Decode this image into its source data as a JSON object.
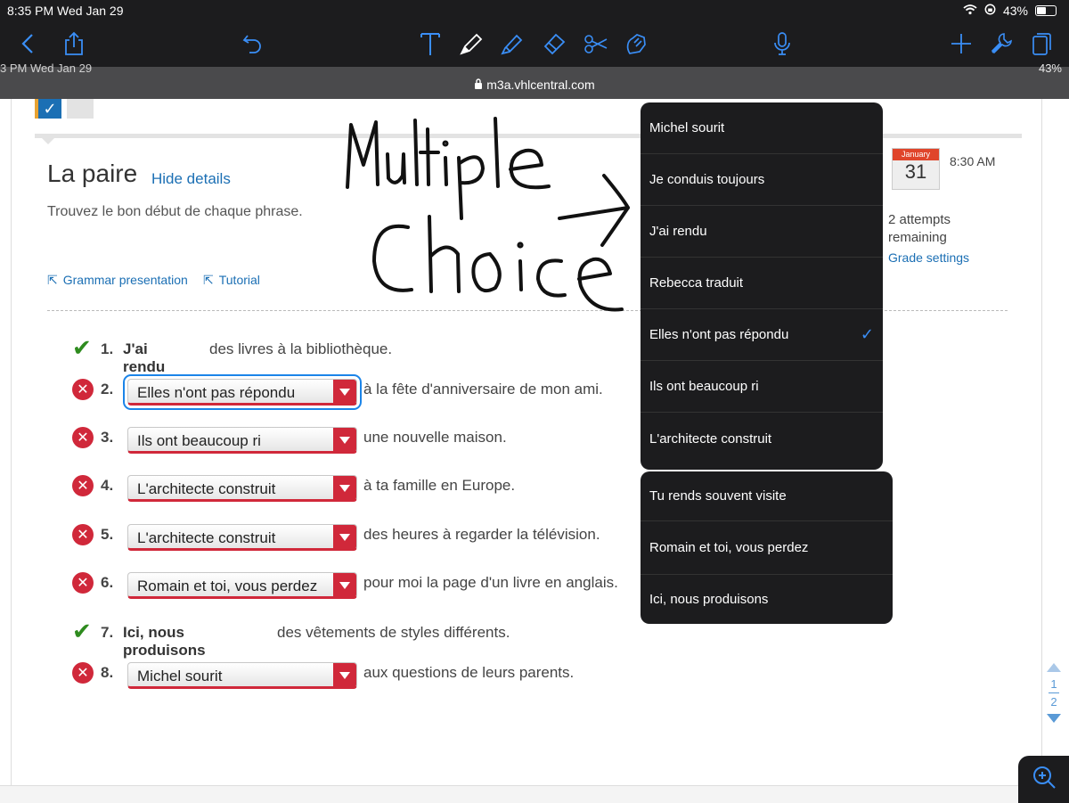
{
  "status_bar": {
    "time": "8:35 PM  Wed Jan 29",
    "battery": "43%"
  },
  "toolbar": {
    "icons": [
      "back-icon",
      "share-icon",
      "undo-icon",
      "text-tool-icon",
      "pen-icon",
      "highlighter-icon",
      "eraser-icon",
      "scissors-icon",
      "lasso-icon",
      "microphone-icon",
      "add-icon",
      "wrench-icon",
      "pages-icon"
    ]
  },
  "browser": {
    "ghost_time": "3 PM  Wed Jan 29",
    "ghost_battery": "43%",
    "url": "m3a.vhlcentral.com"
  },
  "activity": {
    "title": "La paire",
    "hide_details": "Hide details",
    "instructions": "Trouvez le bon début de chaque phrase.",
    "links": [
      "Grammar presentation",
      "Tutorial"
    ],
    "due": {
      "month": "January",
      "day": "31",
      "time": "8:30 AM"
    },
    "attempts": "2 attempts remaining",
    "grade_settings": "Grade settings"
  },
  "questions": [
    {
      "num": "1.",
      "status": "correct",
      "answer": "J'ai rendu",
      "rest": "des livres à la bibliothèque."
    },
    {
      "num": "2.",
      "status": "wrong",
      "selected": "Elles n'ont pas répondu",
      "rest": "à la fête d'anniversaire de mon ami."
    },
    {
      "num": "3.",
      "status": "wrong",
      "selected": "Ils ont beaucoup ri",
      "rest": "une nouvelle maison."
    },
    {
      "num": "4.",
      "status": "wrong",
      "selected": "L'architecte construit",
      "rest": "à ta famille en Europe."
    },
    {
      "num": "5.",
      "status": "wrong",
      "selected": "L'architecte construit",
      "rest": "des heures à regarder la télévision."
    },
    {
      "num": "6.",
      "status": "wrong",
      "selected": "Romain et toi, vous perdez",
      "rest": "pour moi la page d'un livre en anglais."
    },
    {
      "num": "7.",
      "status": "correct",
      "answer": "Ici, nous produisons",
      "rest": "des vêtements de styles différents."
    },
    {
      "num": "8.",
      "status": "wrong",
      "selected": "Michel sourit",
      "rest": "aux questions de leurs parents."
    }
  ],
  "dropdown_options_top": [
    "Michel sourit",
    "Je conduis toujours",
    "J'ai rendu",
    "Rebecca traduit",
    "Elles n'ont pas répondu",
    "Ils ont beaucoup ri",
    "L'architecte construit"
  ],
  "dropdown_selected": "Elles n'ont pas répondu",
  "dropdown_options_bottom": [
    "Tu rends souvent visite",
    "Romain et toi, vous perdez",
    "Ici, nous produisons"
  ],
  "page_nav": {
    "current": "1",
    "total": "2"
  },
  "colors": {
    "accent": "#1b6fb4",
    "error": "#d0283a",
    "correct": "#2e8b1e",
    "popover": "#1c1c1e",
    "check": "#3a8ef6"
  }
}
